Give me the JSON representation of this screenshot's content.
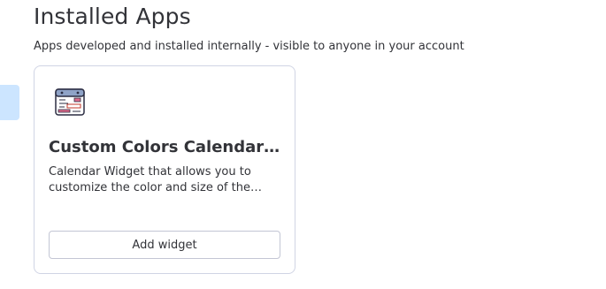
{
  "header": {
    "title": "Installed Apps",
    "subtitle": "Apps developed and installed internally - visible to anyone in your account"
  },
  "apps": [
    {
      "name": "Custom Colors Calendar Widget",
      "description": "Calendar Widget that allows you to customize the color and size of the calendar",
      "icon": "calendar-icon",
      "action_label": "Add widget"
    }
  ],
  "colors": {
    "accent_selected": "#cce5ff",
    "border": "#d0d4e4",
    "text": "#323338"
  }
}
